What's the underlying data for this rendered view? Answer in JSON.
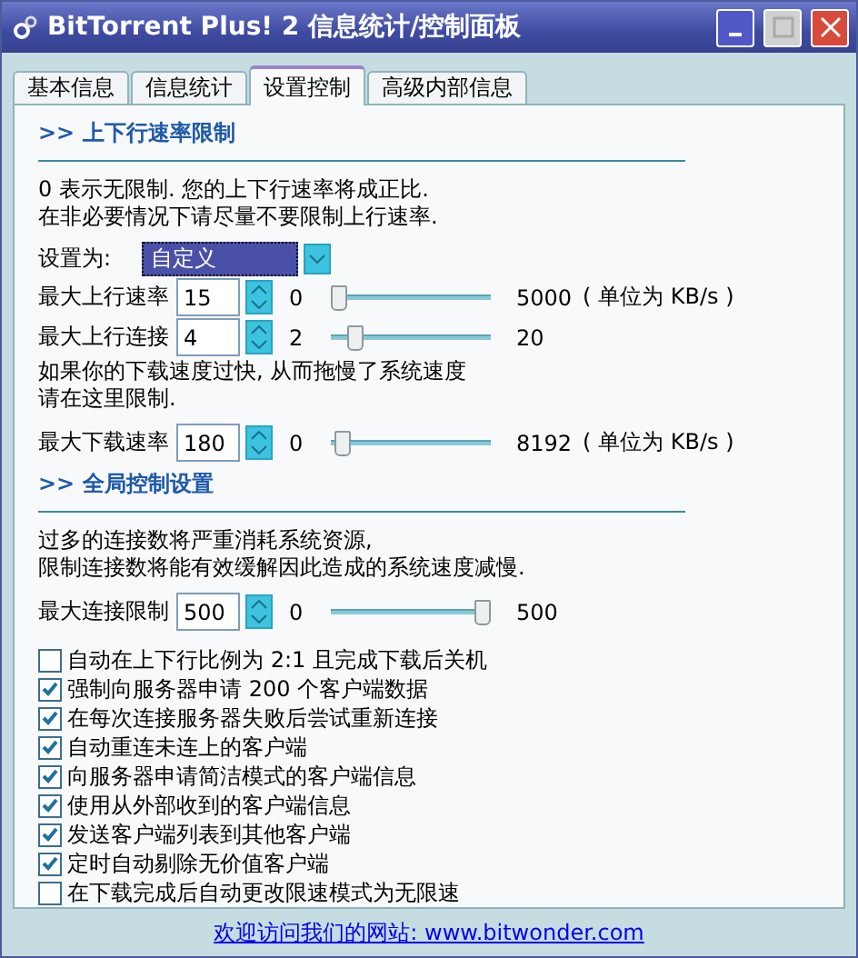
{
  "window": {
    "title": "BitTorrent Plus! 2 信息统计/控制面板"
  },
  "tabs": [
    {
      "label": "基本信息",
      "selected": false
    },
    {
      "label": "信息统计",
      "selected": false
    },
    {
      "label": "设置控制",
      "selected": true
    },
    {
      "label": "高级内部信息",
      "selected": false
    }
  ],
  "sections": [
    {
      "title": ">> 上下行速率限制",
      "blocks": [
        {
          "kind": "note",
          "lines": [
            "0 表示无限制. 您的上下行速率将成正比.",
            "在非必要情况下请尽量不要限制上行速率."
          ]
        },
        {
          "kind": "select",
          "label": "设置为:",
          "value": "自定义"
        },
        {
          "kind": "spin",
          "label": "最大上行速率",
          "value": "15",
          "min": "0",
          "max": "5000",
          "unit": "( 单位为 KB/s )",
          "level": 0.003
        },
        {
          "kind": "spin",
          "label": "最大上行连接",
          "value": "4",
          "min": "2",
          "max": "20",
          "level": 0.11
        },
        {
          "kind": "note",
          "lines": [
            "如果你的下载速度过快, 从而拖慢了系统速度",
            "请在这里限制."
          ]
        },
        {
          "kind": "spin",
          "label": "最大下载速率",
          "value": "180",
          "min": "0",
          "max": "8192",
          "unit": "( 单位为 KB/s )",
          "level": 0.022
        }
      ]
    },
    {
      "title": ">> 全局控制设置",
      "blocks": [
        {
          "kind": "note",
          "lines": [
            "过多的连接数将严重消耗系统资源,",
            "限制连接数将能有效缓解因此造成的系统速度减慢."
          ]
        },
        {
          "kind": "spin",
          "label": "最大连接限制",
          "value": "500",
          "min": "0",
          "max": "500",
          "level": 1
        }
      ]
    }
  ],
  "options": [
    {
      "label": "自动在上下行比例为 2:1 且完成下载后关机",
      "checked": false
    },
    {
      "label": "强制向服务器申请 200 个客户端数据",
      "checked": true
    },
    {
      "label": "在每次连接服务器失败后尝试重新连接",
      "checked": true
    },
    {
      "label": "自动重连未连上的客户端",
      "checked": true
    },
    {
      "label": "向服务器申请简洁模式的客户端信息",
      "checked": true
    },
    {
      "label": "使用从外部收到的客户端信息",
      "checked": true
    },
    {
      "label": "发送客户端列表到其他客户端",
      "checked": true
    },
    {
      "label": "定时自动剔除无价值客户端",
      "checked": true
    },
    {
      "label": "在下载完成后自动更改限速模式为无限速",
      "checked": false
    }
  ],
  "footer": {
    "link": "欢迎访问我们的网站: www.bitwonder.com"
  }
}
